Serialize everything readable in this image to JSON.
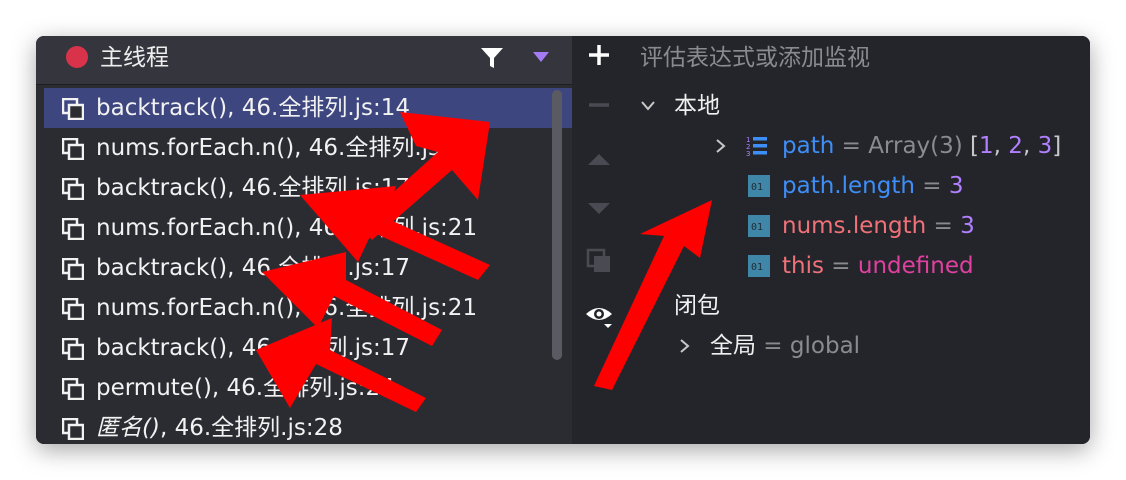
{
  "thread": {
    "name": "主线程"
  },
  "frames": [
    {
      "name": "backtrack()",
      "location": ", 46.全排列.js:14",
      "italic": false,
      "selected": true
    },
    {
      "name": "nums.forEach.n()",
      "location": ", 46.全排列.js:21",
      "italic": false,
      "selected": false
    },
    {
      "name": "backtrack()",
      "location": ", 46.全排列.js:17",
      "italic": false,
      "selected": false
    },
    {
      "name": "nums.forEach.n()",
      "location": ", 46.全排列.js:21",
      "italic": false,
      "selected": false
    },
    {
      "name": "backtrack()",
      "location": ", 46.全排列.js:17",
      "italic": false,
      "selected": false
    },
    {
      "name": "nums.forEach.n()",
      "location": ", 46.全排列.js:21",
      "italic": false,
      "selected": false
    },
    {
      "name": "backtrack()",
      "location": ", 46.全排列.js:17",
      "italic": false,
      "selected": false
    },
    {
      "name": "permute()",
      "location": ", 46.全排列.js:24",
      "italic": false,
      "selected": false
    },
    {
      "name": "匿名()",
      "location": ", 46.全排列.js:28",
      "italic": true,
      "selected": false
    }
  ],
  "watch": {
    "placeholder": "评估表达式或添加监视"
  },
  "scopes": {
    "local": {
      "label": "本地",
      "path": {
        "name": "path",
        "eq": " = ",
        "type": "Array(3)",
        "values": [
          "1",
          "2",
          "3"
        ]
      },
      "path_length": {
        "name": "path.length",
        "eq": " = ",
        "value": "3"
      },
      "nums_length": {
        "name": "nums.length",
        "eq": " = ",
        "value": "3"
      },
      "this": {
        "name": "this",
        "eq": " = ",
        "value": "undefined"
      }
    },
    "closure": {
      "label": "闭包"
    },
    "global": {
      "label": "全局",
      "eq": " = ",
      "value": "global"
    }
  },
  "icons": {
    "thread_status": "red-dot-icon",
    "filter": "filter-icon",
    "frame": "stack-frame-icon",
    "add": "plus-icon",
    "var": "primitive-01-icon",
    "array": "numbered-list-icon",
    "watch": "eye-icon"
  },
  "colors": {
    "accent": "#3e4680",
    "red_dot": "#d8334a",
    "annotation_arrow": "#ff0000"
  }
}
